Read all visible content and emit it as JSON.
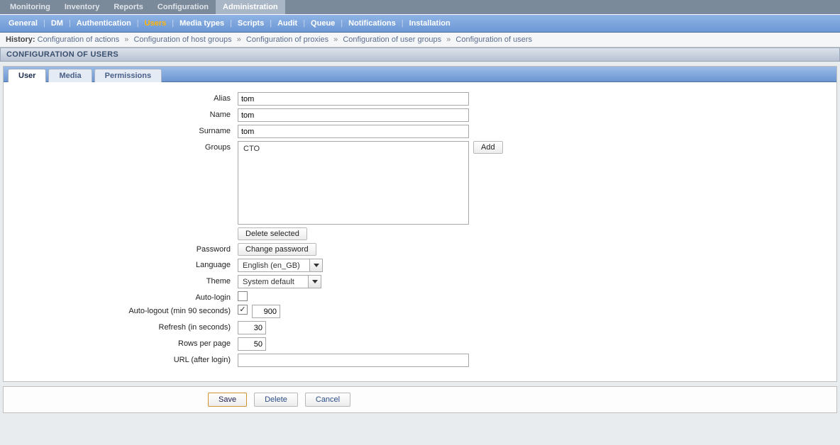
{
  "topnav": {
    "items": [
      "Monitoring",
      "Inventory",
      "Reports",
      "Configuration",
      "Administration"
    ],
    "active_index": 4
  },
  "subnav": {
    "items": [
      "General",
      "DM",
      "Authentication",
      "Users",
      "Media types",
      "Scripts",
      "Audit",
      "Queue",
      "Notifications",
      "Installation"
    ],
    "active_index": 3
  },
  "history": {
    "label": "History:",
    "items": [
      "Configuration of actions",
      "Configuration of host groups",
      "Configuration of proxies",
      "Configuration of user groups",
      "Configuration of users"
    ]
  },
  "section_title": "CONFIGURATION OF USERS",
  "tabs": {
    "items": [
      "User",
      "Media",
      "Permissions"
    ],
    "active_index": 0
  },
  "form": {
    "alias": {
      "label": "Alias",
      "value": "tom"
    },
    "name": {
      "label": "Name",
      "value": "tom"
    },
    "surname": {
      "label": "Surname",
      "value": "tom"
    },
    "groups": {
      "label": "Groups",
      "options": [
        "CTO"
      ],
      "add_label": "Add",
      "delete_label": "Delete selected"
    },
    "password": {
      "label": "Password",
      "button_label": "Change password"
    },
    "language": {
      "label": "Language",
      "value": "English (en_GB)"
    },
    "theme": {
      "label": "Theme",
      "value": "System default"
    },
    "auto_login": {
      "label": "Auto-login",
      "checked": false
    },
    "auto_logout": {
      "label": "Auto-logout (min 90 seconds)",
      "checked": true,
      "value": "900"
    },
    "refresh": {
      "label": "Refresh (in seconds)",
      "value": "30"
    },
    "rows": {
      "label": "Rows per page",
      "value": "50"
    },
    "url": {
      "label": "URL (after login)",
      "value": ""
    }
  },
  "footer": {
    "save": "Save",
    "delete": "Delete",
    "cancel": "Cancel"
  }
}
